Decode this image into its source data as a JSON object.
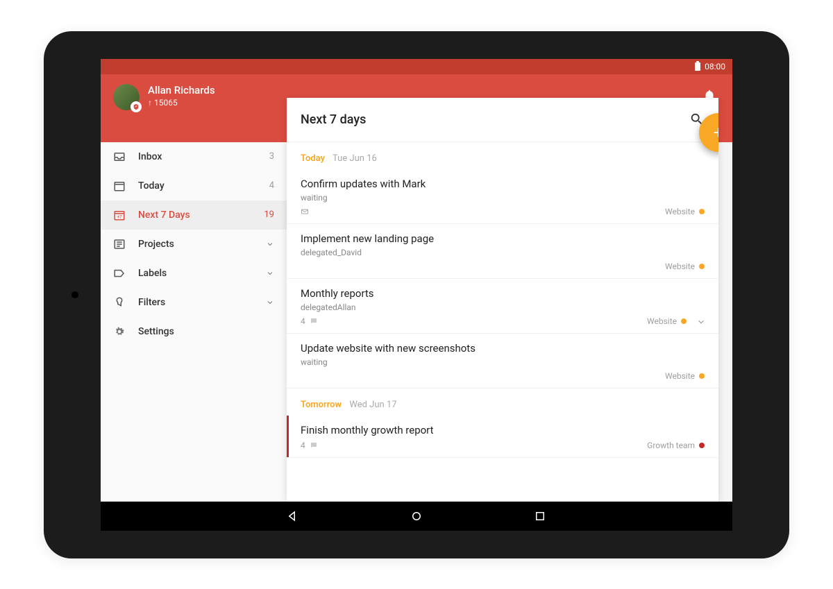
{
  "status": {
    "time": "08:00"
  },
  "user": {
    "name": "Allan Richards",
    "karma": "↑ 15065"
  },
  "sidebar": {
    "items": [
      {
        "label": "Inbox",
        "count": "3"
      },
      {
        "label": "Today",
        "count": "4"
      },
      {
        "label": "Next 7 Days",
        "count": "19"
      },
      {
        "label": "Projects"
      },
      {
        "label": "Labels"
      },
      {
        "label": "Filters"
      },
      {
        "label": "Settings"
      }
    ]
  },
  "main": {
    "title": "Next 7 days",
    "sections": [
      {
        "name": "Today",
        "date": "Tue Jun 16"
      },
      {
        "name": "Tomorrow",
        "date": "Wed Jun 17"
      }
    ],
    "tasks": {
      "today": [
        {
          "title": "Confirm updates with Mark",
          "sub": "waiting",
          "project": "Website",
          "color": "#f9a825",
          "hasMail": true
        },
        {
          "title": "Implement new landing page",
          "sub": "delegated_David",
          "project": "Website",
          "color": "#f9a825"
        },
        {
          "title": "Monthly reports",
          "sub": "delegatedAllan",
          "project": "Website",
          "color": "#f9a825",
          "comments": "4",
          "expandable": true
        },
        {
          "title": "Update website with new screenshots",
          "sub": "waiting",
          "project": "Website",
          "color": "#f9a825"
        }
      ],
      "tomorrow": [
        {
          "title": "Finish monthly growth report",
          "project": "Growth team",
          "color": "#c62828",
          "comments": "4",
          "priority": true
        }
      ]
    }
  }
}
